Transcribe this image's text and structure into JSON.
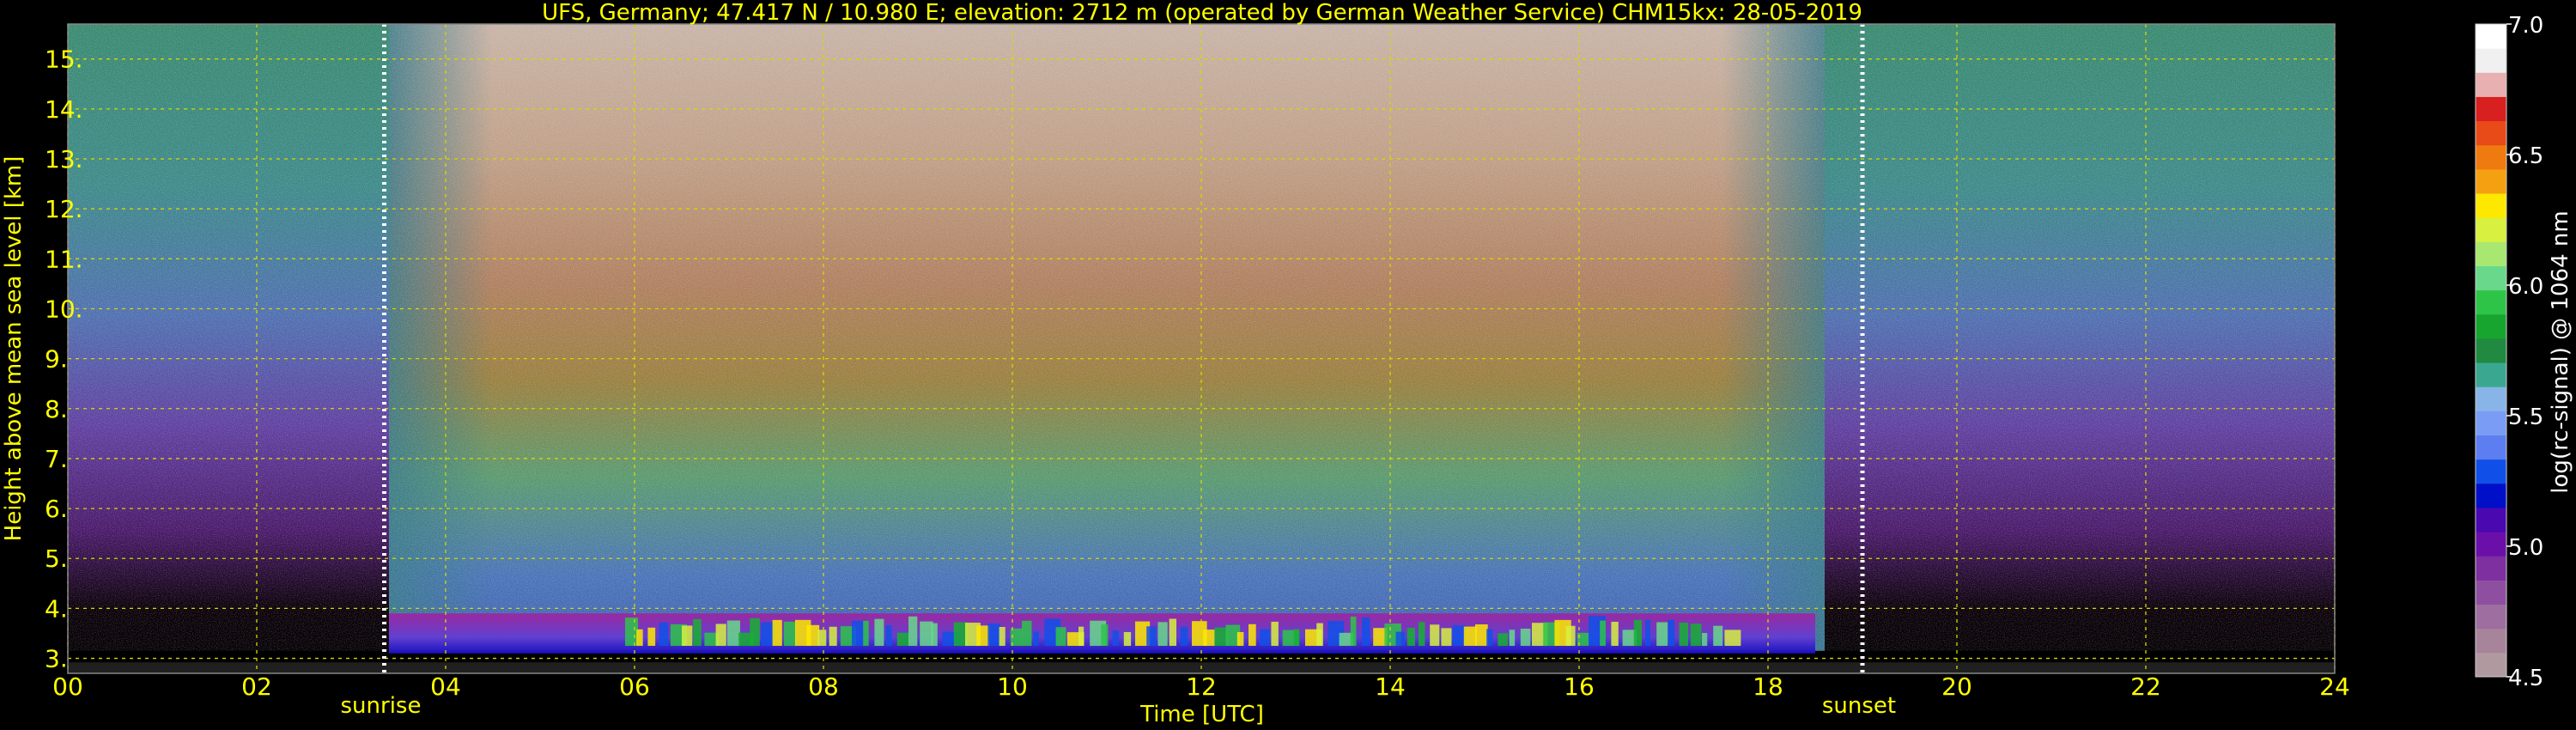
{
  "chart_data": {
    "type": "heatmap",
    "title": "UFS, Germany; 47.417 N / 10.980 E; elevation: 2712 m  (operated by German Weather Service)    CHM15kx: 28-05-2019",
    "xlabel": "Time [UTC]",
    "ylabel": "Height above mean sea level [km]",
    "xlim": [
      0,
      24
    ],
    "ylim": [
      2.7,
      15.7
    ],
    "x_ticks": [
      "00",
      "02",
      "04",
      "06",
      "08",
      "10",
      "12",
      "14",
      "16",
      "18",
      "20",
      "22",
      "24"
    ],
    "x_tick_values": [
      0,
      2,
      4,
      6,
      8,
      10,
      12,
      14,
      16,
      18,
      20,
      22,
      24
    ],
    "y_ticks": [
      "3.",
      "4.",
      "5.",
      "6.",
      "7.",
      "8.",
      "9.",
      "10.",
      "11.",
      "12.",
      "13.",
      "14.",
      "15."
    ],
    "y_tick_values": [
      3,
      4,
      5,
      6,
      7,
      8,
      9,
      10,
      11,
      12,
      13,
      14,
      15
    ],
    "grid": true,
    "events": [
      {
        "label": "sunrise",
        "time": 3.35
      },
      {
        "label": "sunset",
        "time": 19.0
      }
    ],
    "colorbar": {
      "label": "log(rc-signal) @ 1064 nm",
      "range": [
        4.5,
        7.0
      ],
      "ticks": [
        "4.5",
        "5.0",
        "5.5",
        "6.0",
        "6.5",
        "7.0"
      ],
      "tick_values": [
        4.5,
        5.0,
        5.5,
        6.0,
        6.5,
        7.0
      ],
      "colors": [
        "#b09aa0",
        "#a8849b",
        "#9e6ea0",
        "#8f4fa0",
        "#7e2fa0",
        "#6a10a8",
        "#4a08b0",
        "#0010c8",
        "#1050e8",
        "#5d7ef0",
        "#7b9cf5",
        "#88b4e8",
        "#3aa890",
        "#1f8a40",
        "#17a530",
        "#2ec448",
        "#6ad88a",
        "#a8e870",
        "#d8f040",
        "#ffe800",
        "#f5a010",
        "#ef7a10",
        "#e84a18",
        "#d82020",
        "#e8b0b0",
        "#f0f0f0",
        "#ffffff"
      ]
    },
    "signal_profile": {
      "description_of_rendering": "",
      "day_start": 3.4,
      "day_end": 18.6,
      "cloud_layer_km": [
        3.1,
        3.9
      ],
      "cloud_layer_time": [
        3.4,
        18.5
      ]
    }
  }
}
